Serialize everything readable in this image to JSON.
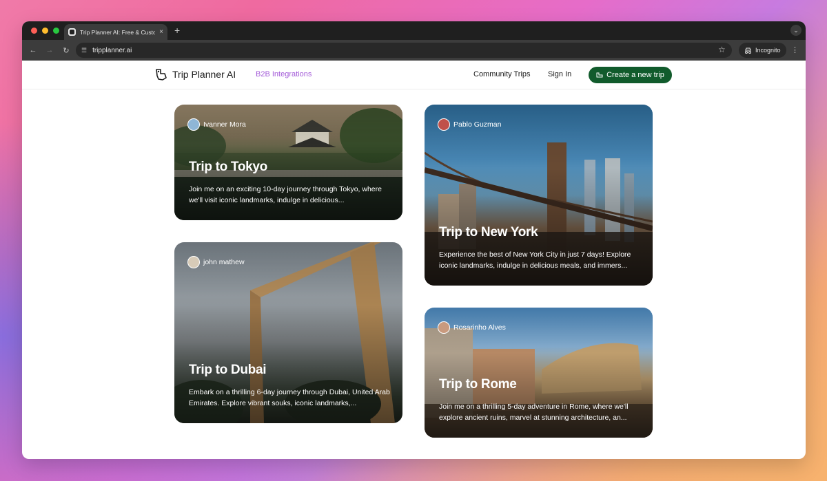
{
  "browser": {
    "tab_title": "Trip Planner AI: Free & Custo",
    "new_tab": "+",
    "tab_close": "×",
    "url": "tripplanner.ai",
    "incognito_label": "Incognito"
  },
  "header": {
    "logo_text": "Trip Planner AI",
    "b2b_link": "B2B Integrations",
    "community_link": "Community Trips",
    "signin_link": "Sign In",
    "create_button": "Create a new trip",
    "accent": "#115b2c",
    "b2b_color": "#a35ad8"
  },
  "cards": [
    {
      "author": "Ivanner Mora",
      "title": "Trip to Tokyo",
      "description": "Join me on an exciting 10-day journey through Tokyo, where we'll visit iconic landmarks, indulge in delicious..."
    },
    {
      "author": "Pablo Guzman",
      "title": "Trip to New York",
      "description": "Experience the best of New York City in just 7 days! Explore iconic landmarks, indulge in delicious meals, and immers..."
    },
    {
      "author": "john mathew",
      "title": "Trip to Dubai",
      "description": "Embark on a thrilling 6-day journey through Dubai, United Arab Emirates. Explore vibrant souks, iconic landmarks,..."
    },
    {
      "author": "Rosarinho Alves",
      "title": "Trip to Rome",
      "description": "Join me on a thrilling 5-day adventure in Rome, where we'll explore ancient ruins, marvel at stunning architecture, an..."
    }
  ]
}
